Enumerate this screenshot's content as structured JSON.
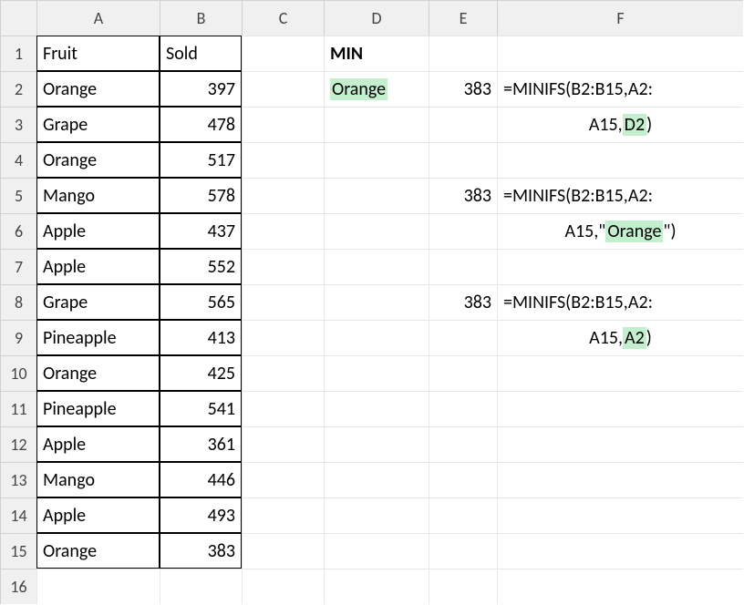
{
  "cols": [
    "A",
    "B",
    "C",
    "D",
    "E",
    "F"
  ],
  "rows": [
    "1",
    "2",
    "3",
    "4",
    "5",
    "6",
    "7",
    "8",
    "9",
    "10",
    "11",
    "12",
    "13",
    "14",
    "15",
    "16"
  ],
  "headers": {
    "fruit": "Fruit",
    "sold": "Sold"
  },
  "fruits": [
    "Orange",
    "Grape",
    "Orange",
    "Mango",
    "Apple",
    "Apple",
    "Grape",
    "Pineapple",
    "Orange",
    "Pineapple",
    "Apple",
    "Mango",
    "Apple",
    "Orange"
  ],
  "sold": [
    "397",
    "478",
    "517",
    "578",
    "437",
    "552",
    "565",
    "413",
    "425",
    "541",
    "361",
    "446",
    "493",
    "383"
  ],
  "D1": "MIN",
  "D2": "Orange",
  "results": {
    "E2": "383",
    "E5": "383",
    "E8": "383"
  },
  "formulas": {
    "F2a": "=MINIFS(B2:B15,A2:",
    "F2b_pre": "A15,",
    "F2b_hi": "D2",
    "F2b_post": ")",
    "F5a": "=MINIFS(B2:B15,A2:",
    "F5b_pre": "A15,\"",
    "F5b_hi": "Orange",
    "F5b_post": "\")",
    "F8a": "=MINIFS(B2:B15,A2:",
    "F8b_pre": "A15,",
    "F8b_hi": "A2",
    "F8b_post": ")"
  }
}
